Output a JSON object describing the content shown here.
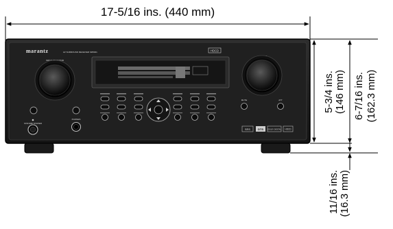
{
  "dimensions": {
    "width": "17-5/16 ins. (440 mm)",
    "height_body_in": "5-3/4 ins.",
    "height_body_mm": "(146 mm)",
    "height_total_in": "6-7/16 ins.",
    "height_total_mm": "(162.3 mm)",
    "foot_in": "11/16 ins.",
    "foot_mm": "(16.3 mm)"
  },
  "device": {
    "brand": "marantz",
    "model_line": "AV SURROUND RECEIVER SR5001",
    "hdcd_badge": "HDCD",
    "labels": {
      "input_selector": "INPUT SELECTOR",
      "volume": "VOLUME",
      "standby": "STANDBY/POWER",
      "phones": "PHONES",
      "mute": "MUTE",
      "att": "ATT"
    },
    "logo_badges": [
      "SRS",
      "DTS",
      "DOLBY DIGITAL",
      "HDCD"
    ]
  },
  "colors": {
    "chassis": "#1b1b1b",
    "panel": "#232323",
    "display": "#3a3a3a",
    "line": "#000000"
  }
}
